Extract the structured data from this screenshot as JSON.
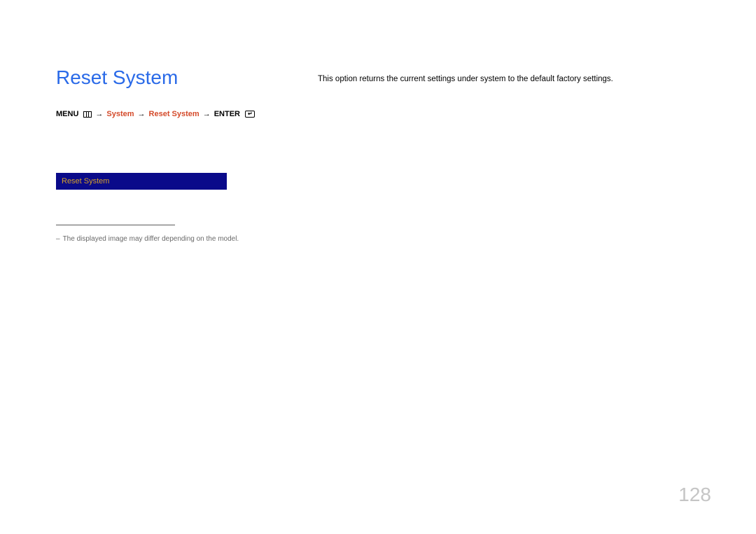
{
  "title": "Reset System",
  "breadcrumb": {
    "menu_label": "MENU",
    "system_label": "System",
    "reset_system_label": "Reset System",
    "enter_label": "ENTER",
    "arrow": "→"
  },
  "menu_preview": {
    "selected_item": "Reset System"
  },
  "note": {
    "dash": "–",
    "text": "The displayed image may differ depending on the model."
  },
  "description": "This option returns the current settings under system to the default factory settings.",
  "page_number": "128"
}
